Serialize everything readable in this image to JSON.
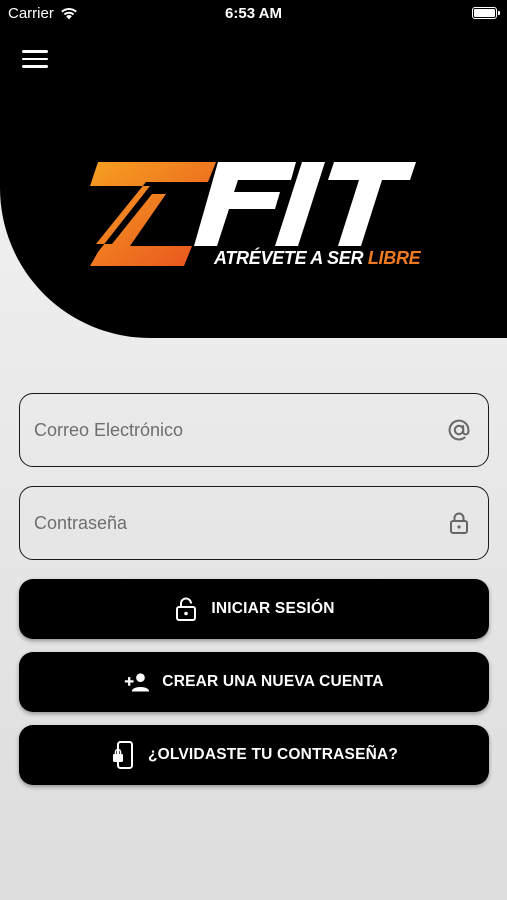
{
  "status_bar": {
    "carrier": "Carrier",
    "time": "6:53 AM",
    "icons": [
      "wifi-icon",
      "battery-icon"
    ]
  },
  "header": {
    "menu_icon": "hamburger-menu-icon",
    "logo_text": "ZFIT",
    "tagline_main": "ATRÉVETE A SER ",
    "tagline_accent": "LIBRE",
    "accent_color": "#f07a22"
  },
  "form": {
    "email": {
      "placeholder": "Correo Electrónico",
      "value": "",
      "icon": "at-sign-icon"
    },
    "password": {
      "placeholder": "Contraseña",
      "value": "",
      "icon": "lock-icon"
    }
  },
  "actions": {
    "login": {
      "label": "INICIAR SESIÓN",
      "icon": "unlock-icon"
    },
    "register": {
      "label": "CREAR UNA NUEVA CUENTA",
      "icon": "add-user-icon"
    },
    "forgot": {
      "label": "¿OLVIDASTE TU CONTRASEÑA?",
      "icon": "phone-lock-icon"
    }
  },
  "colors": {
    "primary": "#000000",
    "accent": "#f07a22",
    "background": "#eeeeee"
  }
}
